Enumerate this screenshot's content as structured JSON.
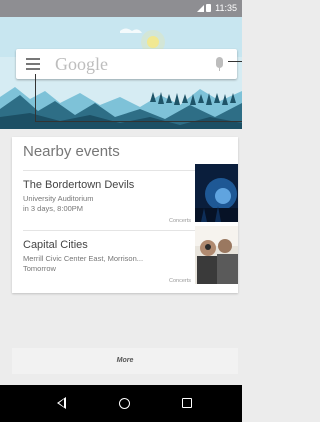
{
  "status_bar": {
    "time": "11:35"
  },
  "search": {
    "placeholder": "Google"
  },
  "card": {
    "title": "Nearby events",
    "events": [
      {
        "title": "The Bordertown Devils",
        "venue": "University Auditorium",
        "when": "in 3 days, 8:00PM",
        "tag": "Concerts"
      },
      {
        "title": "Capital Cities",
        "venue": "Merrill Civic Center East, Morrison...",
        "when": "Tomorrow",
        "tag": "Concerts"
      }
    ]
  },
  "more": {
    "label": "More"
  },
  "colors": {
    "status_bar": "#8e8e92",
    "sky": "#d6ecf3",
    "mountain": "#2e6e86",
    "nav_bar": "#000000"
  }
}
